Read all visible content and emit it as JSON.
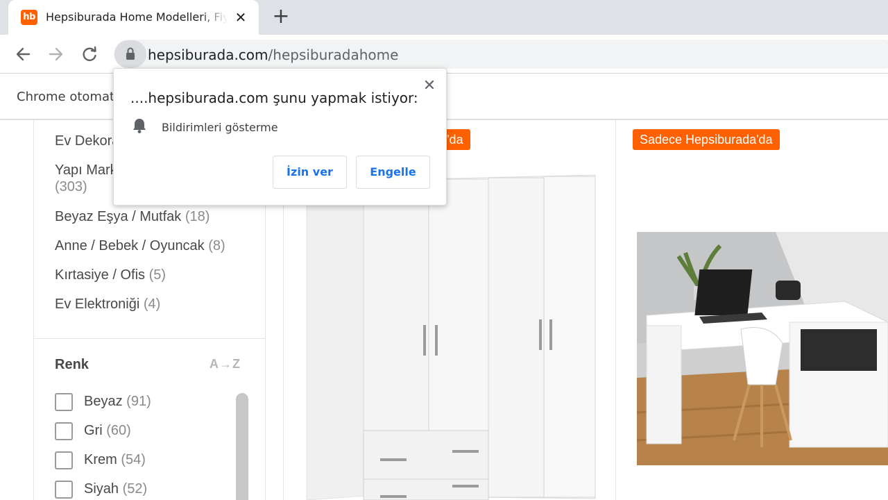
{
  "browser": {
    "tab": {
      "favicon_text": "hb",
      "title": "Hepsiburada Home Modelleri, Fiyatları",
      "close_icon": "close-icon"
    },
    "new_tab_icon": "plus-icon",
    "nav": {
      "back_icon": "arrow-left-icon",
      "forward_icon": "arrow-right-icon",
      "reload_icon": "reload-icon"
    },
    "address": {
      "lock_icon": "lock-icon",
      "domain": "hepsiburada.com",
      "path": "/hepsiburadahome"
    },
    "infobar_text": "Chrome otomatik test yazılımı tarafından kontrol ediliyor."
  },
  "permission_popup": {
    "title": "....hepsiburada.com şunu yapmak istiyor:",
    "permission_icon": "bell-icon",
    "permission_text": "Bildirimleri gösterme",
    "allow_label": "İzin ver",
    "block_label": "Engelle",
    "close_icon": "close-icon"
  },
  "sidebar": {
    "categories": [
      {
        "name": "Ev Dekorasyon",
        "count": ""
      },
      {
        "name": "Yapı Market",
        "count": "(303)"
      },
      {
        "name": "Beyaz Eşya / Mutfak",
        "count": "(18)"
      },
      {
        "name": "Anne / Bebek / Oyuncak",
        "count": "(8)"
      },
      {
        "name": "Kırtasiye / Ofis",
        "count": "(5)"
      },
      {
        "name": "Ev Elektroniği",
        "count": "(4)"
      }
    ],
    "color_filter": {
      "title": "Renk",
      "sort_label": "A→Z",
      "options": [
        {
          "name": "Beyaz",
          "count": "(91)"
        },
        {
          "name": "Gri",
          "count": "(60)"
        },
        {
          "name": "Krem",
          "count": "(54)"
        },
        {
          "name": "Siyah",
          "count": "(52)"
        }
      ]
    }
  },
  "products": [
    {
      "badge": "Sadece Hepsiburada'da",
      "image": "white-wardrobe"
    },
    {
      "badge": "Sadece Hepsiburada'da",
      "image": "white-corner-desk"
    }
  ],
  "colors": {
    "brand_orange": "#ff6000",
    "link_blue": "#1a73e8"
  }
}
